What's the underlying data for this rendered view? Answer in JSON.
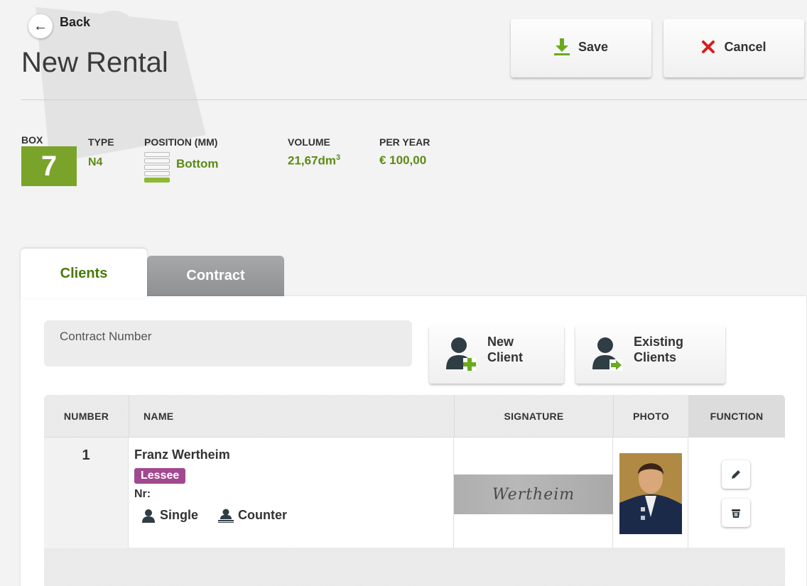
{
  "header": {
    "back_label": "Back",
    "title": "New Rental",
    "save_label": "Save",
    "cancel_label": "Cancel"
  },
  "box": {
    "box_label": "BOX",
    "box_number": "7",
    "type_label": "TYPE",
    "type_value": "N4",
    "position_label": "POSITION (MM)",
    "position_value": "Bottom",
    "position_level": "bottom",
    "volume_label": "VOLUME",
    "volume_value": "21,67dm",
    "volume_unit_exp": "3",
    "per_year_label": "PER YEAR",
    "per_year_value": "€ 100,00"
  },
  "tabs": [
    {
      "label": "Clients",
      "active": true
    },
    {
      "label": "Contract",
      "active": false
    }
  ],
  "clients": {
    "contract_number_placeholder": "Contract Number",
    "new_client_line1": "New",
    "new_client_line2": "Client",
    "existing_clients_line1": "Existing",
    "existing_clients_line2": "Clients"
  },
  "table": {
    "columns": [
      "NUMBER",
      "NAME",
      "SIGNATURE",
      "PHOTO",
      "FUNCTION"
    ],
    "rows": [
      {
        "number": "1",
        "name": "Franz Wertheim",
        "role": "Lessee",
        "nr_label": "Nr:",
        "tag1": "Single",
        "tag2": "Counter"
      }
    ]
  },
  "colors": {
    "accent_green": "#7aa32a",
    "value_green": "#5d8a15",
    "role_purple": "#a1498f",
    "cancel_red": "#d81e1e",
    "icon_dark": "#2f3d44",
    "add_green": "#6aaa1e"
  }
}
